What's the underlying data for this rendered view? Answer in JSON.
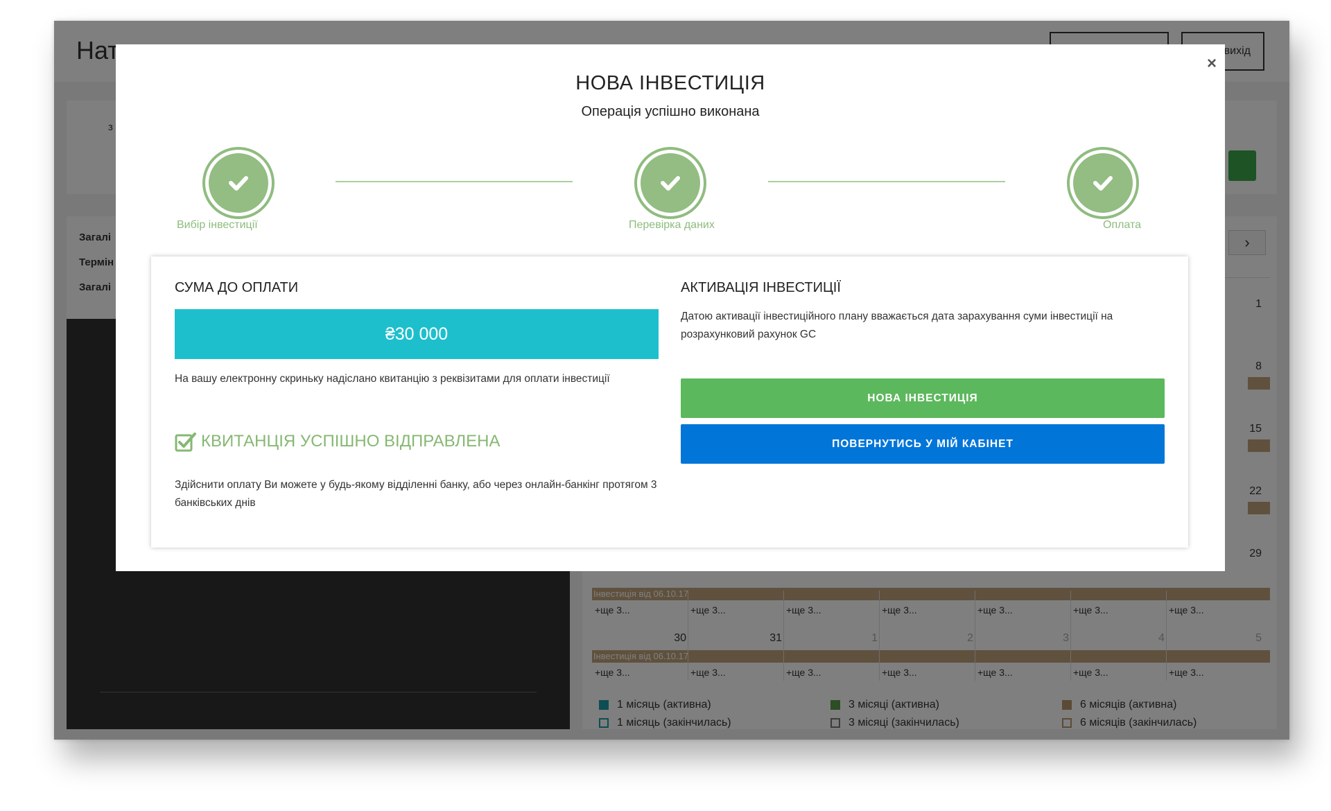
{
  "app": {
    "header_title": "Нат",
    "header_buttons": [
      "",
      "вихід"
    ]
  },
  "stats": {
    "label": "з"
  },
  "left_panel": {
    "info_rows": [
      "Загалі",
      "Термін",
      "Загалі"
    ]
  },
  "calendar": {
    "nav_next": "›",
    "row_days": [
      {
        "day": "1"
      },
      {
        "day": "8"
      },
      {
        "day": "15"
      },
      {
        "day": "22"
      },
      {
        "day": "29"
      }
    ],
    "event_label": "Інвестиція від 06.10.17",
    "more_label": "+ще 3...",
    "last_row_days": [
      "30",
      "31",
      "1",
      "2",
      "3",
      "4",
      "5"
    ]
  },
  "legend": [
    {
      "label": "1 місяць (активна)",
      "color": "#1a9aa6",
      "filled": true
    },
    {
      "label": "1 місяць (закінчилась)",
      "color": "#1a9aa6",
      "filled": false
    },
    {
      "label": "3 місяці (активна)",
      "color": "#5a9a48",
      "filled": true
    },
    {
      "label": "3 місяці (закінчилась)",
      "color": "#777777",
      "filled": false
    },
    {
      "label": "6 місяців (активна)",
      "color": "#b6956a",
      "filled": true
    },
    {
      "label": "6 місяців (закінчилась)",
      "color": "#b6956a",
      "filled": false
    }
  ],
  "modal": {
    "close": "×",
    "title": "НОВА ІНВЕСТИЦІЯ",
    "subtitle": "Операція успішно виконана",
    "steps": [
      {
        "label": "Вибір інвестиції",
        "icon": "check-icon",
        "done": true
      },
      {
        "label": "Перевірка даних",
        "icon": "check-icon",
        "done": true
      },
      {
        "label": "Оплата",
        "icon": "check-icon",
        "done": true
      }
    ],
    "payment": {
      "heading": "СУМА ДО ОПЛАТИ",
      "amount": "₴30 000",
      "email_note": "На вашу електронну скриньку надіслано квитанцію з реквізитами для оплати інвестиції",
      "sent_label": "КВИТАНЦІЯ УСПІШНО ВІДПРАВЛЕНА",
      "bank_note": "Здійснити оплату Ви можете у будь-якому відділенні банку, або через онлайн-банкінг протягом 3 банківських днів"
    },
    "activation": {
      "heading": "АКТИВАЦІЯ ІНВЕСТИЦІЇ",
      "note": "Датою активації інвестиційного плану вважається дата зарахування суми інвестиції на розрахунковий рахунок GC",
      "new_button": "НОВА ІНВЕСТИЦІЯ",
      "back_button": "ПОВЕРНУТИСЬ У МІЙ КАБІНЕТ"
    }
  },
  "colors": {
    "accent_green": "#5cb85c",
    "accent_blue": "#0275d8",
    "amount_teal": "#1ebfcd",
    "step_green": "#93bd83"
  }
}
